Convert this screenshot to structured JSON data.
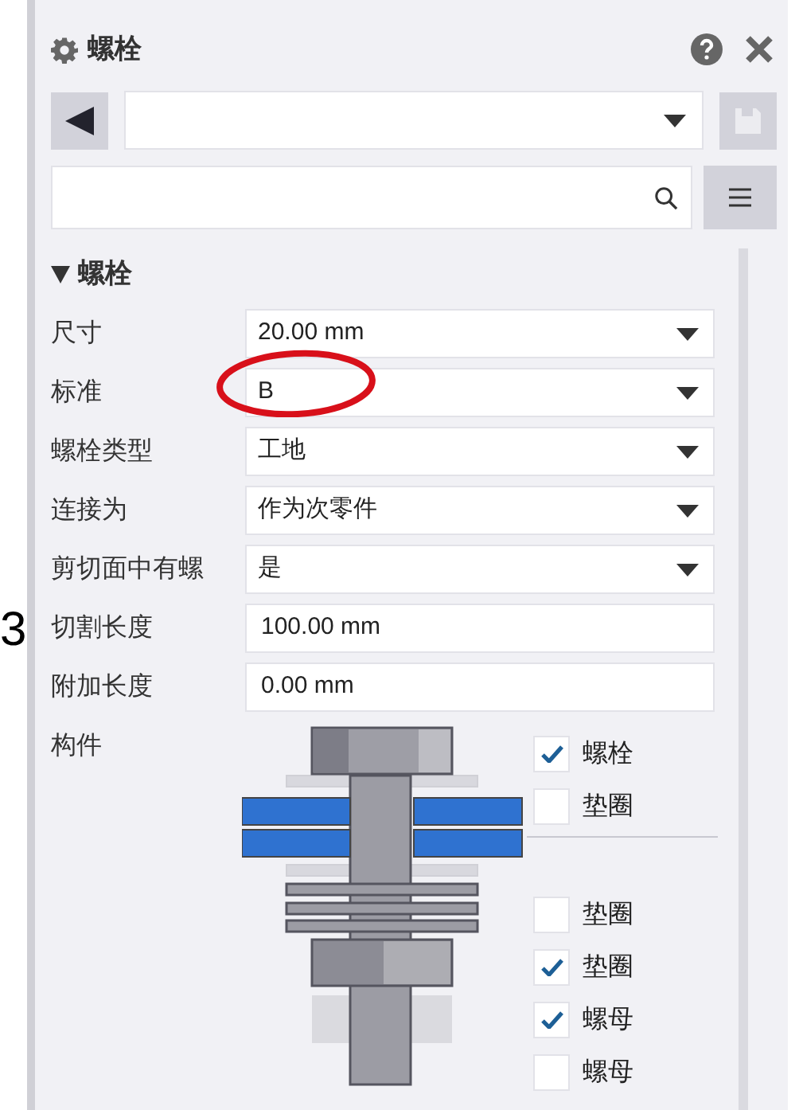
{
  "edge_text": "3",
  "panel": {
    "title": "螺栓"
  },
  "section": {
    "title": "螺栓",
    "expanded": true
  },
  "properties": [
    {
      "label": "尺寸",
      "kind": "dropdown",
      "value": "20.00 mm"
    },
    {
      "label": "标准",
      "kind": "dropdown",
      "value": "B"
    },
    {
      "label": "螺栓类型",
      "kind": "dropdown",
      "value": "工地"
    },
    {
      "label": "连接为",
      "kind": "dropdown",
      "value": "作为次零件"
    },
    {
      "label": "剪切面中有螺",
      "kind": "dropdown",
      "value": "是"
    },
    {
      "label": "切割长度",
      "kind": "text",
      "value": "100.00 mm"
    },
    {
      "label": "附加长度",
      "kind": "text",
      "value": "0.00 mm"
    }
  ],
  "components": {
    "label": "构件",
    "upper": [
      {
        "label": "螺栓",
        "checked": true
      },
      {
        "label": "垫圈",
        "checked": false
      }
    ],
    "lower": [
      {
        "label": "垫圈",
        "checked": false
      },
      {
        "label": "垫圈",
        "checked": true
      },
      {
        "label": "螺母",
        "checked": true
      },
      {
        "label": "螺母",
        "checked": false
      }
    ]
  }
}
